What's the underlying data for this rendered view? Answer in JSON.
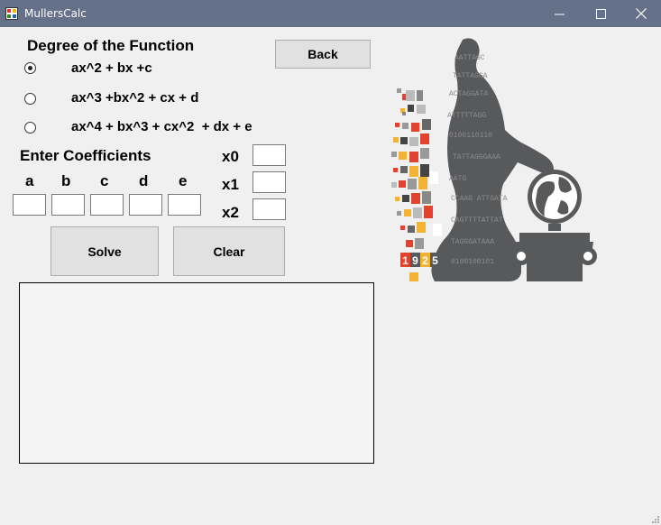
{
  "window": {
    "title": "MullersCalc",
    "controls": {
      "minimize": "—",
      "maximize": "☐",
      "close": "✕"
    }
  },
  "degree": {
    "heading": "Degree of the Function",
    "options": [
      {
        "label": "ax^2 + bx +c",
        "selected": true
      },
      {
        "label": "ax^3 +bx^2 + cx + d",
        "selected": false
      },
      {
        "label": "ax^4 + bx^3 + cx^2  + dx + e",
        "selected": false
      }
    ]
  },
  "back_button": "Back",
  "coefficients": {
    "heading": "Enter Coefficients",
    "labels": [
      "a",
      "b",
      "c",
      "d",
      "e"
    ],
    "values": [
      "",
      "",
      "",
      "",
      ""
    ]
  },
  "initial_guesses": {
    "labels": [
      "x0",
      "x1",
      "x2"
    ],
    "values": [
      "",
      "",
      ""
    ]
  },
  "solve_button": "Solve",
  "clear_button": "Clear",
  "output": {
    "text": ""
  },
  "logo": {
    "year_digits": [
      "1",
      "9",
      "2",
      "5"
    ]
  }
}
